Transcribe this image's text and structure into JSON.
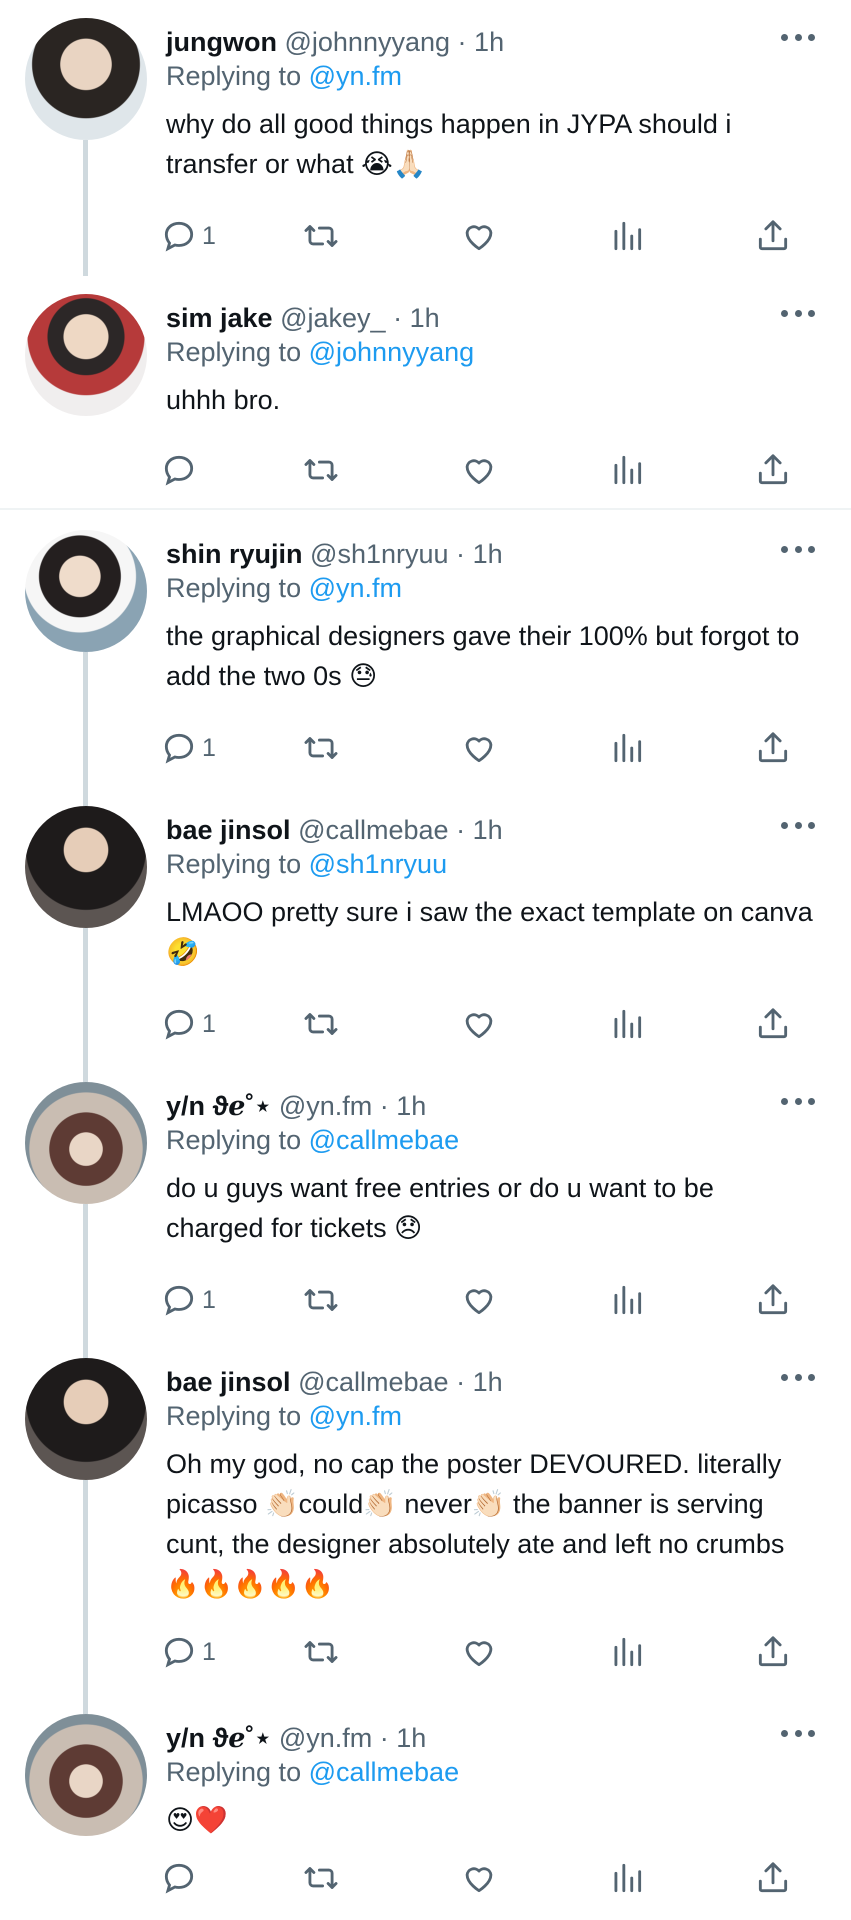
{
  "colors": {
    "text": "#0f1419",
    "muted": "#536471",
    "link": "#1d9bf0",
    "line": "#cfd9de"
  },
  "tweets": [
    {
      "name": "jungwon",
      "handle": "@johnnyyang",
      "time": "1h",
      "replying_label": "Replying to",
      "replying_to": "@yn.fm",
      "text": "why do all good things happen in JYPA should i transfer or what 😭🙏🏻",
      "reply_count": "1"
    },
    {
      "name": "sim jake",
      "handle": "@jakey_",
      "time": "1h",
      "replying_label": "Replying to",
      "replying_to": "@johnnyyang",
      "text": "uhhh bro.",
      "reply_count": ""
    },
    {
      "name": "shin ryujin",
      "handle": "@sh1nryuu",
      "time": "1h",
      "replying_label": "Replying to",
      "replying_to": "@yn.fm",
      "text": "the graphical designers gave their 100% but forgot to add the two 0s 😓",
      "reply_count": "1"
    },
    {
      "name": "bae jinsol",
      "handle": "@callmebae",
      "time": "1h",
      "replying_label": "Replying to",
      "replying_to": "@sh1nryuu",
      "text": "LMAOO pretty sure i saw the exact template on canva 🤣",
      "reply_count": "1"
    },
    {
      "name": "y/n ϑℯ˚⋆",
      "handle": "@yn.fm",
      "time": "1h",
      "replying_label": "Replying to",
      "replying_to": "@callmebae",
      "text": "do u guys want free entries or do u want to be charged for tickets  😞",
      "reply_count": "1"
    },
    {
      "name": "bae jinsol",
      "handle": "@callmebae",
      "time": "1h",
      "replying_label": "Replying to",
      "replying_to": "@yn.fm",
      "text": "Oh my god, no cap the poster DEVOURED. literally picasso 👏🏻could👏🏻 never👏🏻 the banner is serving cunt, the designer absolutely ate and left no crumbs 🔥🔥🔥🔥🔥",
      "reply_count": "1"
    },
    {
      "name": "y/n ϑℯ˚⋆",
      "handle": "@yn.fm",
      "time": "1h",
      "replying_label": "Replying to",
      "replying_to": "@callmebae",
      "text": "😍❤️",
      "reply_count": ""
    }
  ],
  "icons": {
    "reply": "reply-icon",
    "retweet": "retweet-icon",
    "like": "heart-icon",
    "views": "views-icon",
    "share": "share-icon",
    "more": "more-icon"
  }
}
